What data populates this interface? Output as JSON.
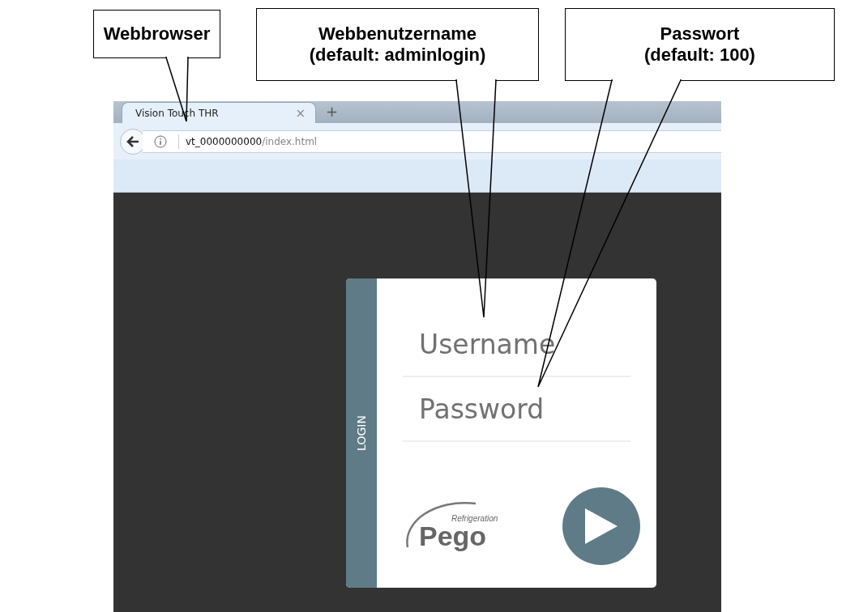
{
  "callouts": [
    {
      "lines": [
        "Webbrowser"
      ]
    },
    {
      "lines": [
        "Webbenutzername",
        "(default: adminlogin)"
      ]
    },
    {
      "lines": [
        "Passwort",
        "(default: 100)"
      ]
    }
  ],
  "browser": {
    "tab_title": "Vision Touch THR",
    "tab_close": "×",
    "new_tab": "+",
    "url_host": "vt_0000000000",
    "url_path": "/index.html"
  },
  "login": {
    "side_label": "LOGIN",
    "username_placeholder": "Username",
    "password_placeholder": "Password",
    "logo": {
      "tagline": "Refrigeration",
      "brand": "Pego"
    }
  }
}
